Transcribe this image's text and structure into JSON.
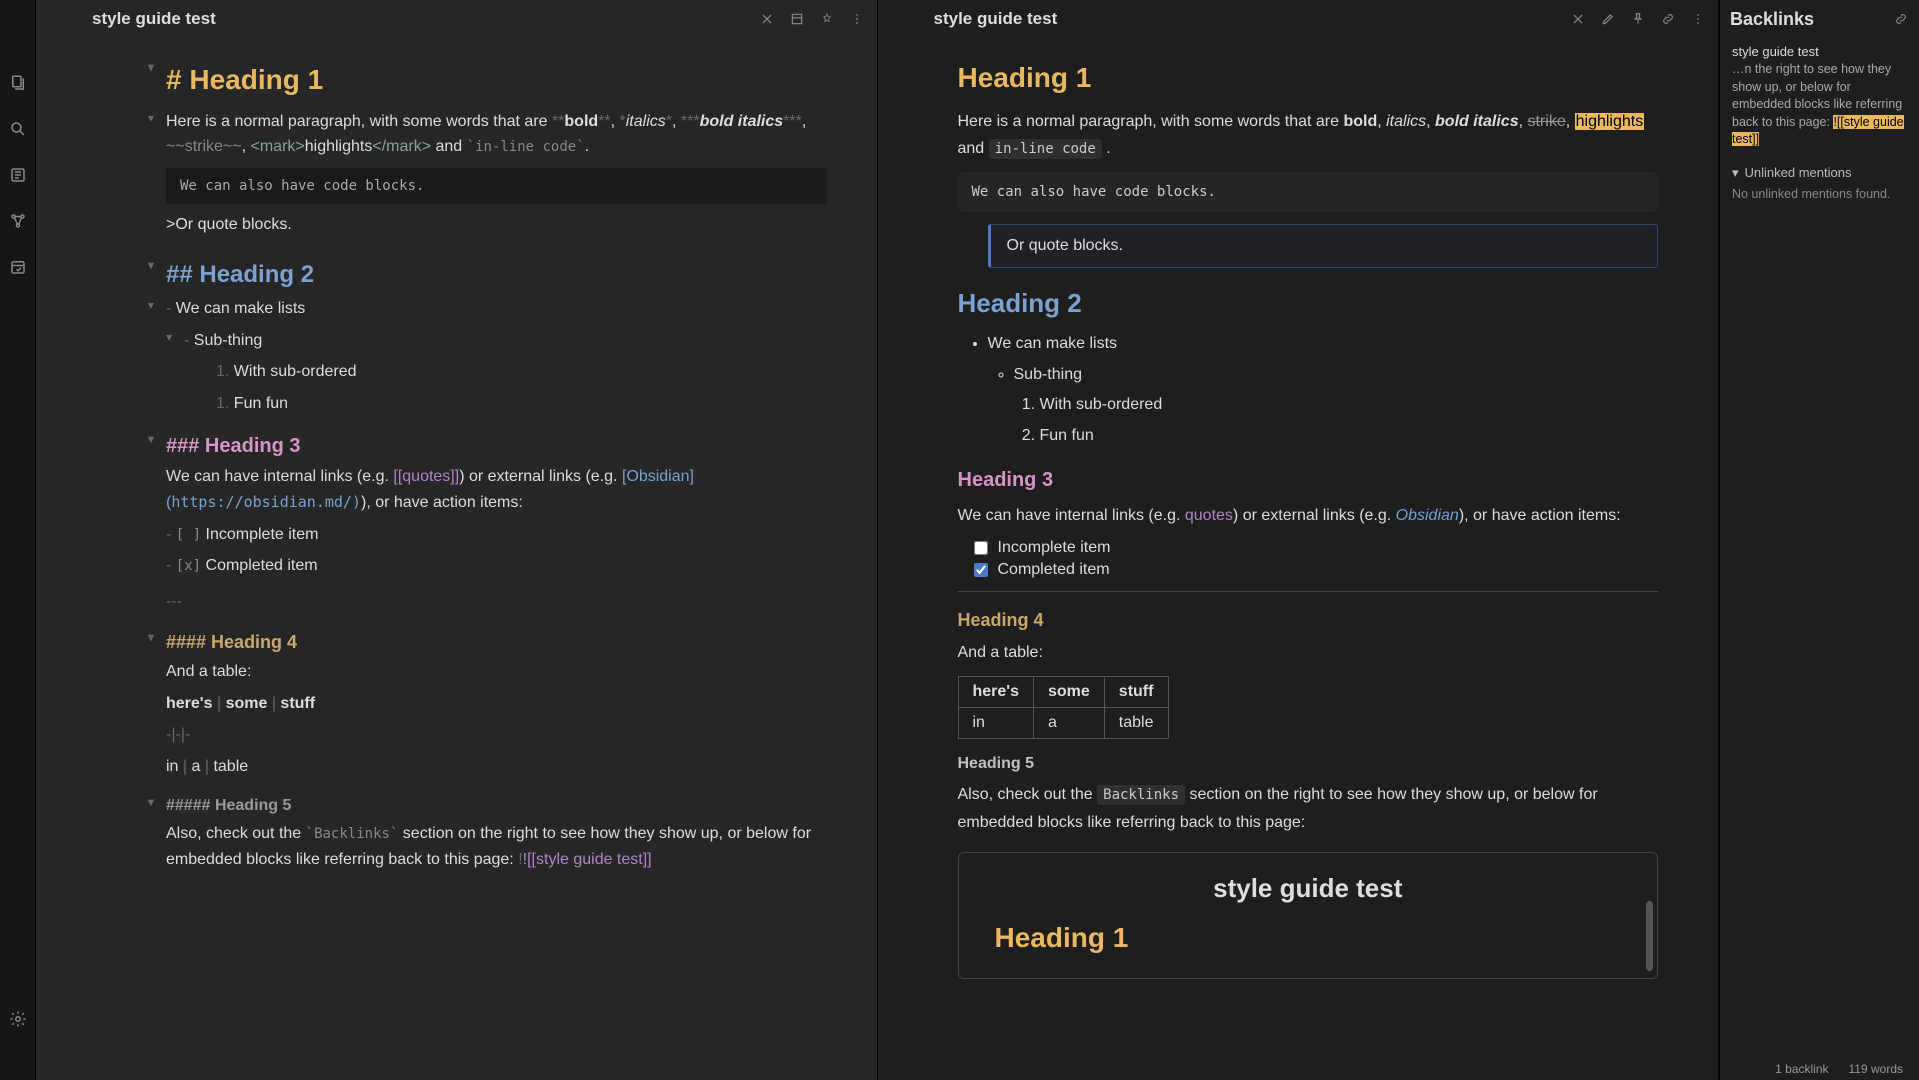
{
  "tabs": {
    "left_title": "style guide test",
    "right_title": "style guide test"
  },
  "source": {
    "h1": "# Heading 1",
    "para1_a": "Here is a normal paragraph, with some words that are ",
    "para1_bold": "**bold**",
    "para1_c": ", ",
    "para1_italic": "*italics*",
    "para1_e": ", ",
    "para1_bi": "***bold italics***",
    "para1_g": ", ",
    "para1_strike": "~~strike~~",
    "para1_i": ", ",
    "mark_open": "<mark>",
    "mark_text": "highlights",
    "mark_close": "</mark>",
    "para1_and": " and ",
    "para1_code": "`in-line code`",
    "para1_end": ".",
    "code_block": "We can also have code blocks.",
    "quote": ">Or quote blocks.",
    "h2": "## Heading 2",
    "list1": "- We can make lists",
    "list2": "- Sub-thing",
    "list3": "1. With sub-ordered",
    "list4": "1. Fun fun",
    "h3": "### Heading 3",
    "h3_para_a": "We can have internal links (e.g. ",
    "h3_internal": "[[quotes]]",
    "h3_para_b": ") or external links (e.g. ",
    "h3_ext_text": "[Obsidian](",
    "h3_ext_url": "https://obsidian.md/)",
    "h3_para_c": "), or have action items:",
    "task1": "- [ ] Incomplete item",
    "task2": "- [x] Completed item",
    "hr": "---",
    "h4": "#### Heading 4",
    "table_intro": "And a table:",
    "table_r1": "here's | some | stuff",
    "table_r2": "-|-|-",
    "table_r3": "in | a | table",
    "h5": "##### Heading 5",
    "h5_para_a": "Also, check out the ",
    "h5_code": "`Backlinks`",
    "h5_para_b": " section on the right to see how they show up, or below for embedded blocks like referring back to this page: ",
    "h5_embed": "![[style guide test]]"
  },
  "preview": {
    "h1": "Heading 1",
    "p1_a": "Here is a normal paragraph, with some words that are ",
    "p1_bold": "bold",
    "p1_c": ", ",
    "p1_italic": "italics",
    "p1_e": ", ",
    "p1_bi": "bold italics",
    "p1_g": ", ",
    "p1_strike": "strike",
    "p1_i": ", ",
    "p1_hl": "highlights",
    "p1_and": " and ",
    "p1_code": "in-line code",
    "p1_end": " .",
    "code_block": "We can also have code blocks.",
    "quote": "Or quote blocks.",
    "h2": "Heading 2",
    "li1": "We can make lists",
    "li2": "Sub-thing",
    "li3": "With sub-ordered",
    "li4": "Fun fun",
    "h3": "Heading 3",
    "p3_a": "We can have internal links (e.g. ",
    "p3_quotes": "quotes",
    "p3_b": ") or external links (e.g. ",
    "p3_obsidian": "Obsidian",
    "p3_c": "), or have action items:",
    "task1": "Incomplete item",
    "task2": "Completed item",
    "h4": "Heading 4",
    "table_intro": "And a table:",
    "th1": "here's",
    "th2": "some",
    "th3": "stuff",
    "td1": "in",
    "td2": "a",
    "td3": "table",
    "h5": "Heading 5",
    "p5_a": "Also, check out the ",
    "p5_code": "Backlinks",
    "p5_b": " section on the right to see how they show up, or below for embedded blocks like referring back to this page:",
    "embed_title": "style guide test",
    "embed_h1": "Heading 1"
  },
  "backlinks": {
    "title": "Backlinks",
    "item_title": "style guide test",
    "snippet_a": "…n the right to see how they show up, or below for embedded blocks like referring back to this page: ",
    "snippet_hl": "![[style guide test]]",
    "unlinked_label": "Unlinked mentions",
    "empty": "No unlinked mentions found."
  },
  "status": {
    "backlinks": "1 backlink",
    "words": "119 words"
  }
}
